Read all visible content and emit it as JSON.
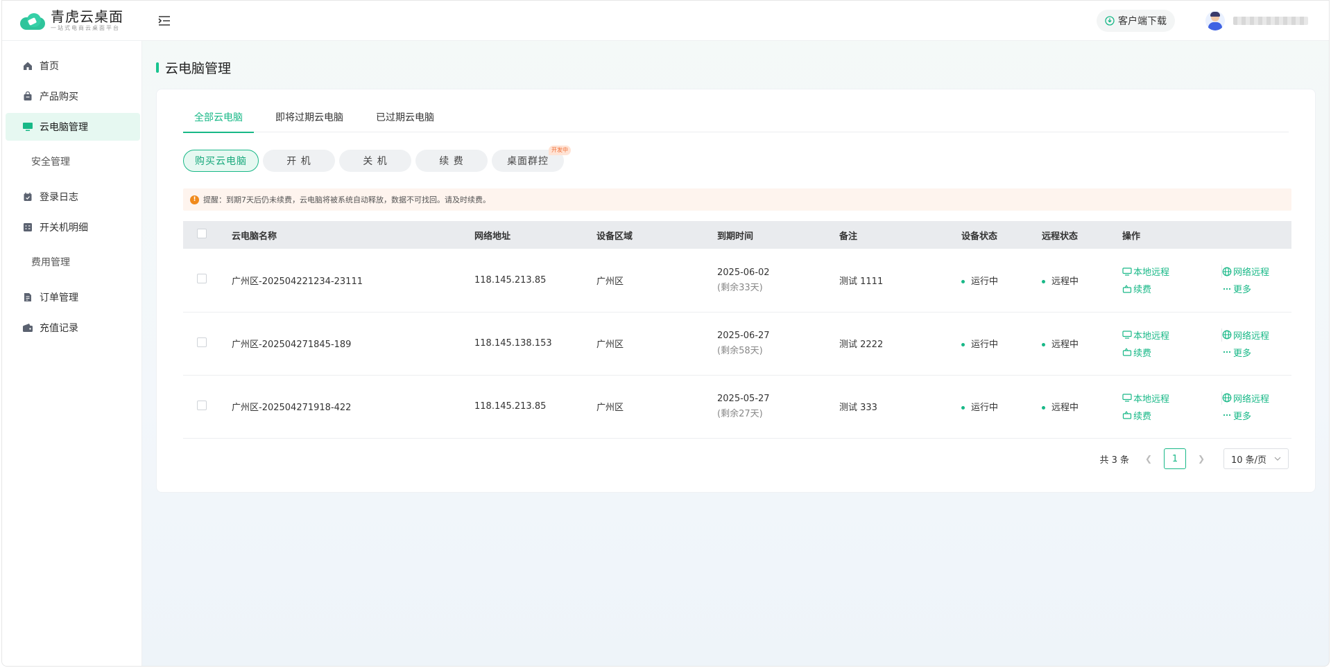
{
  "brand": {
    "title": "青虎云桌面",
    "subtitle": "一站式电商云桌面平台"
  },
  "header": {
    "download_label": "客户端下载",
    "user_name": "**********"
  },
  "sidebar": {
    "items": [
      {
        "label": "首页",
        "icon": "home-icon"
      },
      {
        "label": "产品购买",
        "icon": "bag-icon"
      },
      {
        "label": "云电脑管理",
        "icon": "monitor-icon",
        "active": true
      },
      {
        "label": "安全管理"
      },
      {
        "label": "登录日志",
        "icon": "calendar-icon"
      },
      {
        "label": "开关机明细",
        "icon": "list-icon"
      },
      {
        "label": "费用管理"
      },
      {
        "label": "订单管理",
        "icon": "document-icon"
      },
      {
        "label": "充值记录",
        "icon": "wallet-icon"
      }
    ]
  },
  "page": {
    "title": "云电脑管理"
  },
  "tabs": [
    "全部云电脑",
    "即将过期云电脑",
    "已过期云电脑"
  ],
  "actions": {
    "buy": "购买云电脑",
    "power_on": "开 机",
    "power_off": "关 机",
    "renew": "续 费",
    "group_control": "桌面群控",
    "group_tag": "开发中"
  },
  "notice": "提醒：到期7天后仍未续费，云电脑将被系统自动释放，数据不可找回。请及时续费。",
  "table": {
    "columns": [
      "云电脑名称",
      "网络地址",
      "设备区域",
      "到期时间",
      "备注",
      "设备状态",
      "远程状态",
      "操作"
    ],
    "rows": [
      {
        "name": "广州区-202504221234-23111",
        "ip": "118.145.213.85",
        "region": "广州区",
        "expire": "2025-06-02",
        "remain": "(剩余33天)",
        "note": "测试 1111",
        "device_status": "运行中",
        "remote_status": "远程中"
      },
      {
        "name": "广州区-202504271845-189",
        "ip": "118.145.138.153",
        "region": "广州区",
        "expire": "2025-06-27",
        "remain": "(剩余58天)",
        "note": "测试 2222",
        "device_status": "运行中",
        "remote_status": "远程中"
      },
      {
        "name": "广州区-202504271918-422",
        "ip": "118.145.213.85",
        "region": "广州区",
        "expire": "2025-05-27",
        "remain": "(剩余27天)",
        "note": "测试 333",
        "device_status": "运行中",
        "remote_status": "远程中"
      }
    ],
    "ops": {
      "local": "本地远程",
      "network": "网络远程",
      "renew": "续费",
      "more": "更多"
    }
  },
  "pagination": {
    "total": "共 3 条",
    "current": "1",
    "page_size": "10 条/页"
  },
  "colors": {
    "accent": "#18b887",
    "notice_bg": "#fef4ee",
    "active_bg": "#e6f8f1"
  }
}
